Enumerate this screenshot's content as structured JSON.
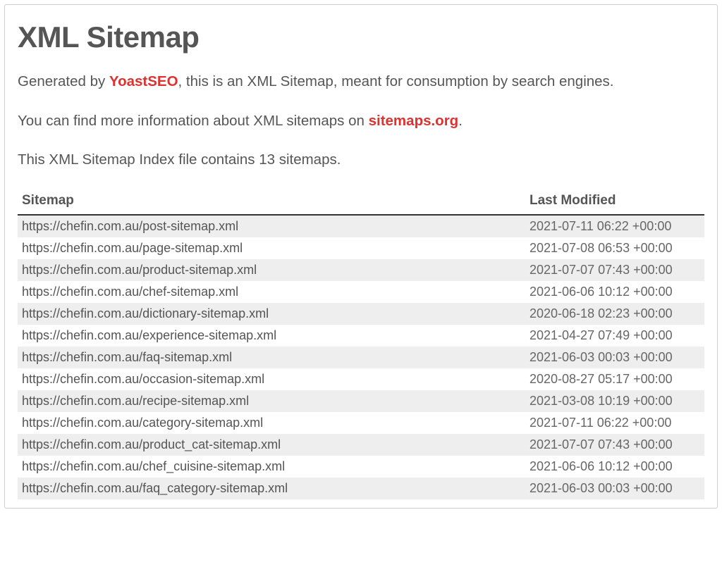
{
  "page": {
    "title": "XML Sitemap",
    "intro": {
      "generated_prefix": "Generated by ",
      "yoast_link": "YoastSEO",
      "generated_suffix": ", this is an XML Sitemap, meant for consumption by search engines.",
      "more_prefix": "You can find more information about XML sitemaps on ",
      "sitemaps_link": "sitemaps.org",
      "more_suffix": ".",
      "count_line": "This XML Sitemap Index file contains 13 sitemaps."
    }
  },
  "table": {
    "headers": {
      "sitemap": "Sitemap",
      "last_modified": "Last Modified"
    },
    "rows": [
      {
        "url": "https://chefin.com.au/post-sitemap.xml",
        "modified": "2021-07-11 06:22 +00:00"
      },
      {
        "url": "https://chefin.com.au/page-sitemap.xml",
        "modified": "2021-07-08 06:53 +00:00"
      },
      {
        "url": "https://chefin.com.au/product-sitemap.xml",
        "modified": "2021-07-07 07:43 +00:00"
      },
      {
        "url": "https://chefin.com.au/chef-sitemap.xml",
        "modified": "2021-06-06 10:12 +00:00"
      },
      {
        "url": "https://chefin.com.au/dictionary-sitemap.xml",
        "modified": "2020-06-18 02:23 +00:00"
      },
      {
        "url": "https://chefin.com.au/experience-sitemap.xml",
        "modified": "2021-04-27 07:49 +00:00"
      },
      {
        "url": "https://chefin.com.au/faq-sitemap.xml",
        "modified": "2021-06-03 00:03 +00:00"
      },
      {
        "url": "https://chefin.com.au/occasion-sitemap.xml",
        "modified": "2020-08-27 05:17 +00:00"
      },
      {
        "url": "https://chefin.com.au/recipe-sitemap.xml",
        "modified": "2021-03-08 10:19 +00:00"
      },
      {
        "url": "https://chefin.com.au/category-sitemap.xml",
        "modified": "2021-07-11 06:22 +00:00"
      },
      {
        "url": "https://chefin.com.au/product_cat-sitemap.xml",
        "modified": "2021-07-07 07:43 +00:00"
      },
      {
        "url": "https://chefin.com.au/chef_cuisine-sitemap.xml",
        "modified": "2021-06-06 10:12 +00:00"
      },
      {
        "url": "https://chefin.com.au/faq_category-sitemap.xml",
        "modified": "2021-06-03 00:03 +00:00"
      }
    ]
  }
}
